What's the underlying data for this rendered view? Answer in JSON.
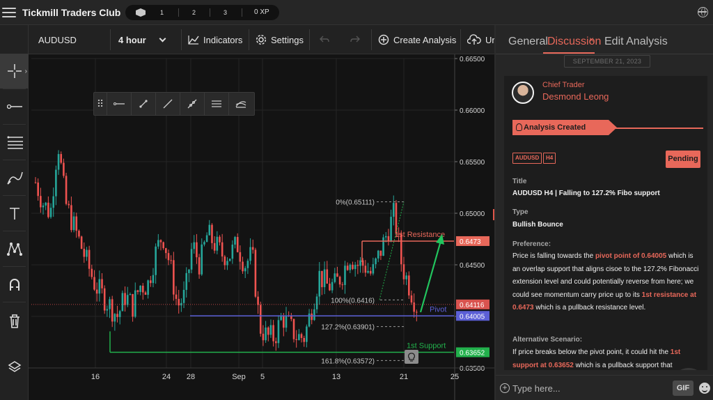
{
  "app": {
    "title": "Tickmill Traders Club"
  },
  "xp": {
    "levels": [
      "1",
      "2",
      "3"
    ],
    "value": "0 XP"
  },
  "chart_toolbar": {
    "symbol": "AUDUSD",
    "timeframe": "4 hour",
    "indicators_label": "Indicators",
    "settings_label": "Settings",
    "create_analysis_label": "Create Analysis",
    "upload_label": "Ur"
  },
  "left_tools": [
    "crosshair",
    "horizontal-ray",
    "fib-lines",
    "brush",
    "text",
    "pattern",
    "magnet",
    "trash",
    "layers"
  ],
  "drawing_toolbar": [
    "horizontal-line",
    "ray",
    "trend-line",
    "extended-line",
    "fib-levels",
    "fib-channel"
  ],
  "colors": {
    "accent": "#e8685a",
    "up": "#26a69a",
    "down": "#ef5350",
    "pivot": "#5b5fd6",
    "support": "#22b14c",
    "resistance": "#e8685a",
    "arrow": "#22c55e"
  },
  "chart_data": {
    "type": "candlestick",
    "symbol": "AUDUSD",
    "timeframe": "4 hour",
    "y_ticks": [
      "0.66500",
      "0.66000",
      "0.65500",
      "0.65000",
      "0.64500",
      "0.64000",
      "0.63500"
    ],
    "ylim": [
      0.635,
      0.665
    ],
    "x_ticks": [
      "16",
      "24",
      "28",
      "Sep",
      "5",
      "13",
      "21",
      "25"
    ],
    "levels": [
      {
        "label": "1st Resistance",
        "value": 0.6473,
        "price_tag": "0.6473"
      },
      {
        "label": "Pivot",
        "value": 0.64005,
        "price_tag": "0.64005"
      },
      {
        "label": "1st Support",
        "value": 0.63652,
        "price_tag": "0.63652"
      },
      {
        "label": "current",
        "value": 0.64116,
        "price_tag": "0.64116"
      }
    ],
    "fib_labels": [
      "0%(0.65111)",
      "100%(0.6416)",
      "127.2%(0.63901)",
      "161.8%(0.63572)"
    ],
    "close_path": [
      0.653,
      0.651,
      0.65,
      0.657,
      0.651,
      0.649,
      0.647,
      0.645,
      0.643,
      0.642,
      0.641,
      0.64,
      0.642,
      0.641,
      0.643,
      0.643,
      0.646,
      0.648,
      0.645,
      0.641,
      0.642,
      0.647,
      0.645,
      0.648,
      0.647,
      0.646,
      0.646,
      0.647,
      0.645,
      0.646,
      0.639,
      0.638,
      0.638,
      0.64,
      0.639,
      0.638,
      0.638,
      0.641,
      0.644,
      0.643,
      0.643,
      0.644,
      0.646,
      0.645,
      0.645,
      0.644,
      0.646,
      0.648,
      0.65,
      0.645,
      0.643,
      0.641
    ]
  },
  "panel": {
    "tabs": [
      "General",
      "Discussion",
      "Edit Analysis"
    ],
    "close_symbol": "×",
    "date": "SEPTEMBER 21, 2023",
    "role": "Chief Trader",
    "author": "Desmond Leong",
    "analysis_created": "Analysis Created",
    "tags": [
      "AUDUSD",
      "H4"
    ],
    "status": "Pending",
    "title_label": "Title",
    "title_value": "AUDUSD H4 | Falling to 127.2% Fibo support",
    "type_label": "Type",
    "type_value": "Bullish Bounce",
    "preference_label": "Preference:",
    "preference": {
      "t1": "Price is falling towards the ",
      "h1": "pivot point of 0.64005",
      "t2": " which is an overlap support that aligns cisoe to the 127.2% Fibonacci extension level and could potentially reverse from here; we could see momentum carry price up to its ",
      "h2": "1st resistance at 0.6473",
      "t3": " which is a pullback resistance level."
    },
    "alt_label": "Alternative Scenario:",
    "alternative": {
      "t1": "If price breaks below the pivot point, it could hit the ",
      "h1": "1st support at 0.63652",
      "t2": " which is a pullback support that"
    },
    "input_placeholder": "Type here...",
    "gif_label": "GIF"
  }
}
